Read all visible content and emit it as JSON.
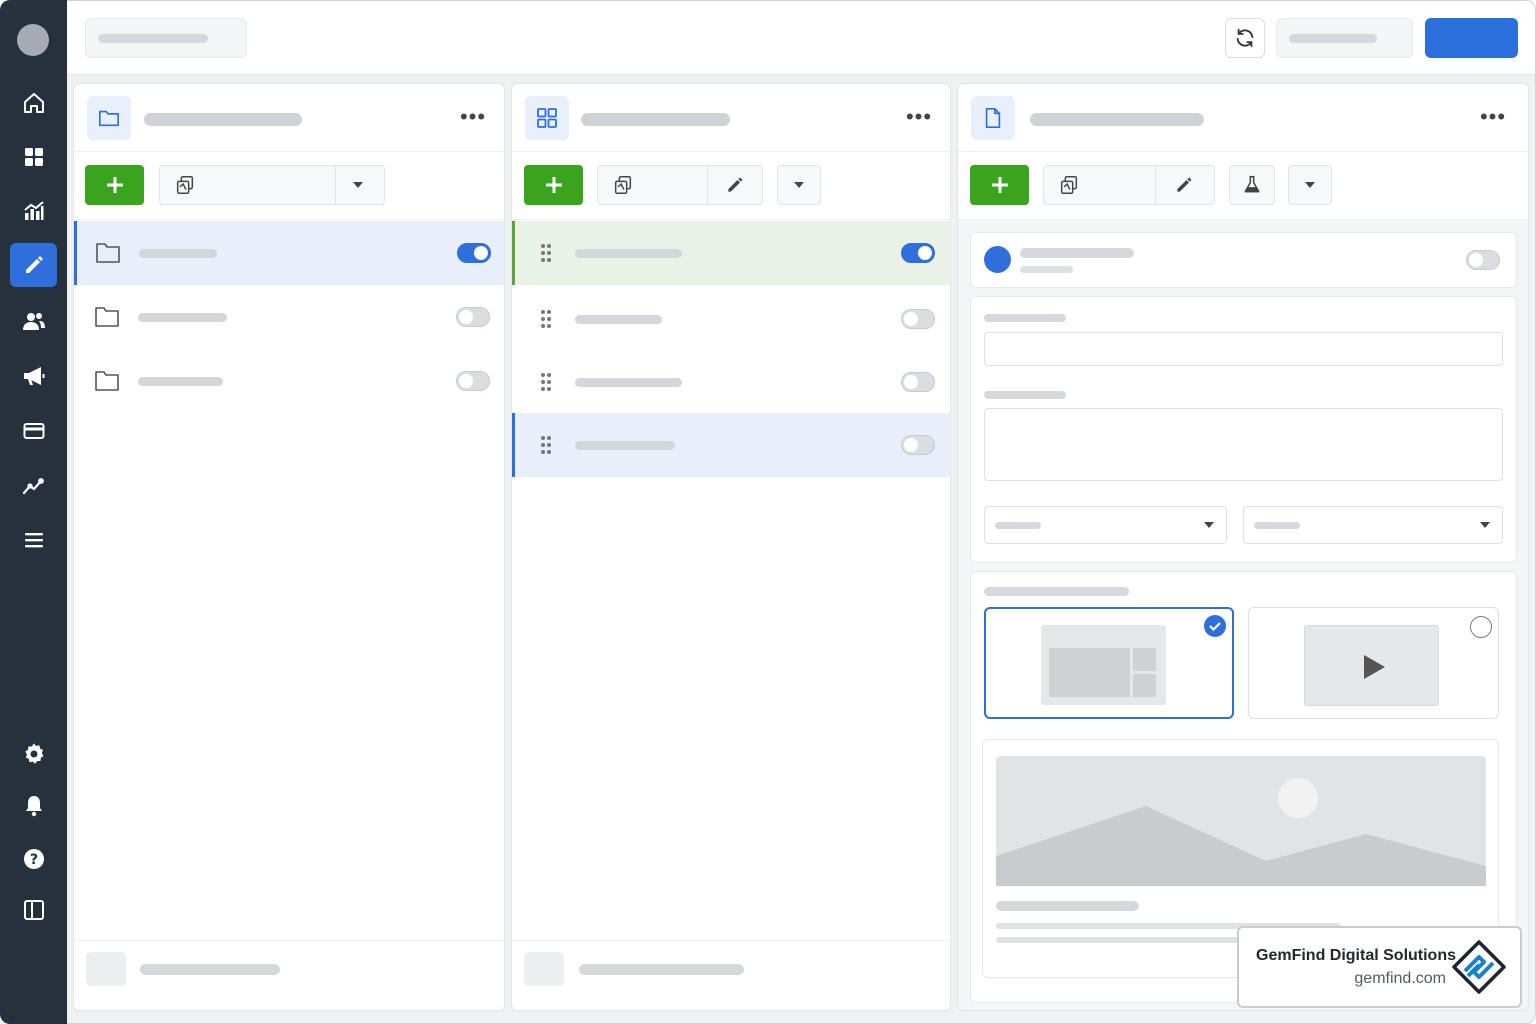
{
  "badge": {
    "name": "GemFind Digital Solutions",
    "url": "gemfind.com"
  },
  "sidebar": {
    "items": [
      {
        "icon": "home-icon",
        "active": false
      },
      {
        "icon": "dashboard-grid-icon",
        "active": false
      },
      {
        "icon": "analytics-chart-icon",
        "active": false
      },
      {
        "icon": "pencil-edit-icon",
        "active": true
      },
      {
        "icon": "users-icon",
        "active": false
      },
      {
        "icon": "megaphone-icon",
        "active": false
      },
      {
        "icon": "credit-card-icon",
        "active": false
      },
      {
        "icon": "trend-line-icon",
        "active": false
      },
      {
        "icon": "menu-list-icon",
        "active": false
      },
      {
        "icon": "gear-icon",
        "active": false
      },
      {
        "icon": "bell-icon",
        "active": false
      },
      {
        "icon": "help-icon",
        "active": false
      },
      {
        "icon": "panel-toggle-icon",
        "active": false
      }
    ]
  },
  "panels": {
    "folders": {
      "icon": "folder-icon",
      "rows": [
        {
          "enabled": true,
          "selected": true
        },
        {
          "enabled": false
        },
        {
          "enabled": false
        }
      ]
    },
    "layouts": {
      "icon": "grid-layout-icon",
      "rows": [
        {
          "enabled": true,
          "selected": true
        },
        {
          "enabled": false
        },
        {
          "enabled": false
        },
        {
          "enabled": false,
          "highlighted": true
        }
      ]
    },
    "detail": {
      "icon": "document-icon",
      "status_enabled": false,
      "layout_options": [
        {
          "type": "layout-grid",
          "selected": true
        },
        {
          "type": "video",
          "selected": false
        }
      ]
    }
  },
  "colors": {
    "sidebar_bg": "#27313d",
    "accent_blue": "#2f6fdc",
    "add_green": "#3aa41f"
  }
}
